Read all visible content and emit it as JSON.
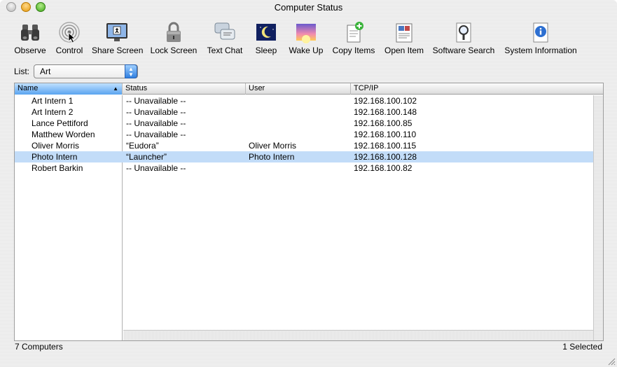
{
  "window": {
    "title": "Computer Status"
  },
  "toolbar": {
    "items": [
      {
        "label": "Observe",
        "icon": "binoculars-icon"
      },
      {
        "label": "Control",
        "icon": "control-signal-icon"
      },
      {
        "label": "Share Screen",
        "icon": "share-screen-icon"
      },
      {
        "label": "Lock Screen",
        "icon": "padlock-icon"
      },
      {
        "label": "Text Chat",
        "icon": "chat-bubbles-icon"
      },
      {
        "label": "Sleep",
        "icon": "moon-icon"
      },
      {
        "label": "Wake Up",
        "icon": "sunrise-icon"
      },
      {
        "label": "Copy Items",
        "icon": "copy-items-icon"
      },
      {
        "label": "Open Item",
        "icon": "open-item-icon"
      },
      {
        "label": "Software Search",
        "icon": "magnifier-icon"
      },
      {
        "label": "System Information",
        "icon": "info-icon"
      }
    ]
  },
  "list": {
    "label": "List:",
    "selected": "Art"
  },
  "table": {
    "columns": [
      "Name",
      "Status",
      "User",
      "TCP/IP"
    ],
    "rows": [
      {
        "name": "Art Intern 1",
        "status": "-- Unavailable --",
        "user": "",
        "ip": "192.168.100.102"
      },
      {
        "name": "Art Intern 2",
        "status": "-- Unavailable --",
        "user": "",
        "ip": "192.168.100.148"
      },
      {
        "name": "Lance Pettiford",
        "status": "-- Unavailable --",
        "user": "",
        "ip": "192.168.100.85"
      },
      {
        "name": "Matthew Worden",
        "status": "-- Unavailable --",
        "user": "",
        "ip": "192.168.100.110"
      },
      {
        "name": "Oliver Morris",
        "status": "“Eudora”",
        "user": "Oliver Morris",
        "ip": "192.168.100.115"
      },
      {
        "name": "Photo Intern",
        "status": "“Launcher”",
        "user": "Photo Intern",
        "ip": "192.168.100.128"
      },
      {
        "name": "Robert Barkin",
        "status": "-- Unavailable --",
        "user": "",
        "ip": "192.168.100.82"
      }
    ],
    "selected_row": 5
  },
  "status_bar": {
    "count": "7 Computers",
    "selection": "1 Selected"
  },
  "colors": {
    "selection": "#c2dcf8",
    "header_sorted": "#5aa4f0"
  }
}
